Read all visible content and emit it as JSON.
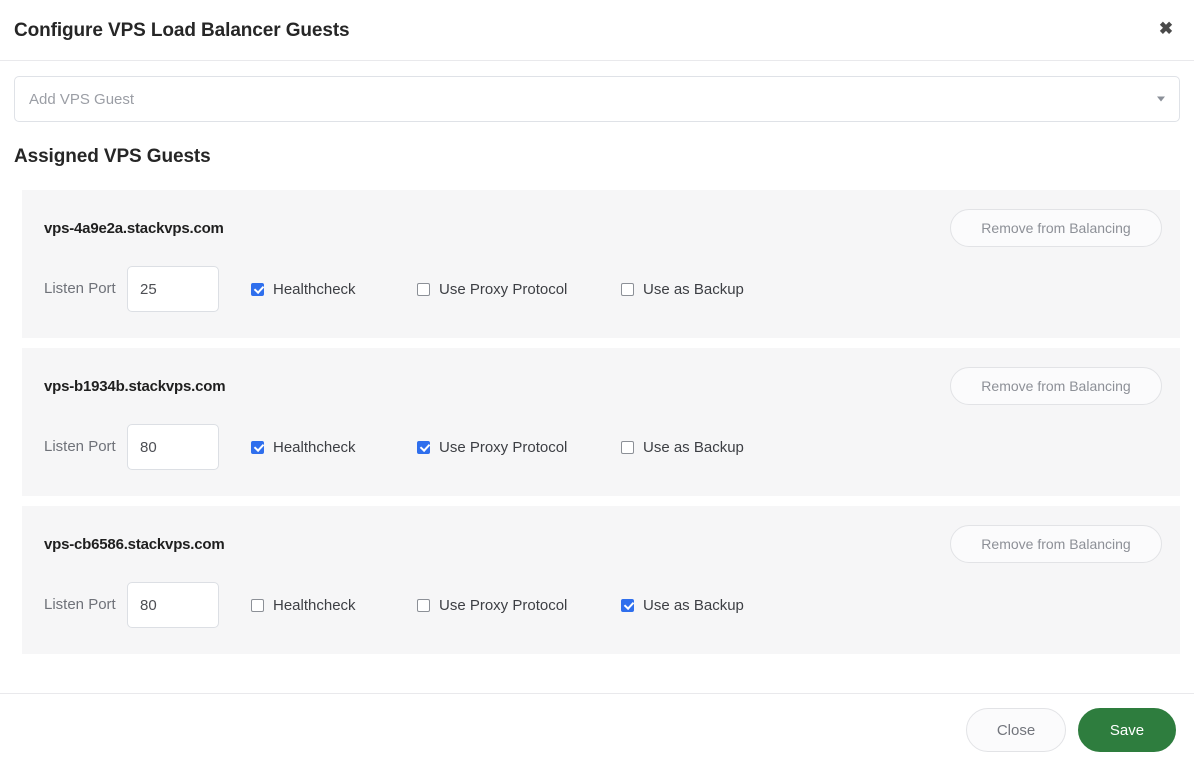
{
  "header": {
    "title": "Configure VPS Load Balancer Guests",
    "close_label": "✖"
  },
  "add_guest": {
    "placeholder": "Add VPS Guest",
    "value": "",
    "caret_icon": "chevron-down-icon"
  },
  "assigned_section": {
    "title": "Assigned VPS Guests"
  },
  "labels": {
    "listen_port": "Listen Port",
    "healthcheck": "Healthcheck",
    "use_proxy_protocol": "Use Proxy Protocol",
    "use_as_backup": "Use as Backup",
    "remove_from_balancing": "Remove from Balancing"
  },
  "guests": [
    {
      "hostname": "vps-4a9e2a.stackvps.com",
      "listen_port": "25",
      "healthcheck": true,
      "use_proxy_protocol": false,
      "use_as_backup": false
    },
    {
      "hostname": "vps-b1934b.stackvps.com",
      "listen_port": "80",
      "healthcheck": true,
      "use_proxy_protocol": true,
      "use_as_backup": false
    },
    {
      "hostname": "vps-cb6586.stackvps.com",
      "listen_port": "80",
      "healthcheck": false,
      "use_proxy_protocol": false,
      "use_as_backup": true
    }
  ],
  "footer": {
    "close_label": "Close",
    "save_label": "Save"
  },
  "colors": {
    "accent_green": "#2e7d3e",
    "checkbox_blue": "#2f6fed",
    "card_background": "#f6f6f7"
  }
}
